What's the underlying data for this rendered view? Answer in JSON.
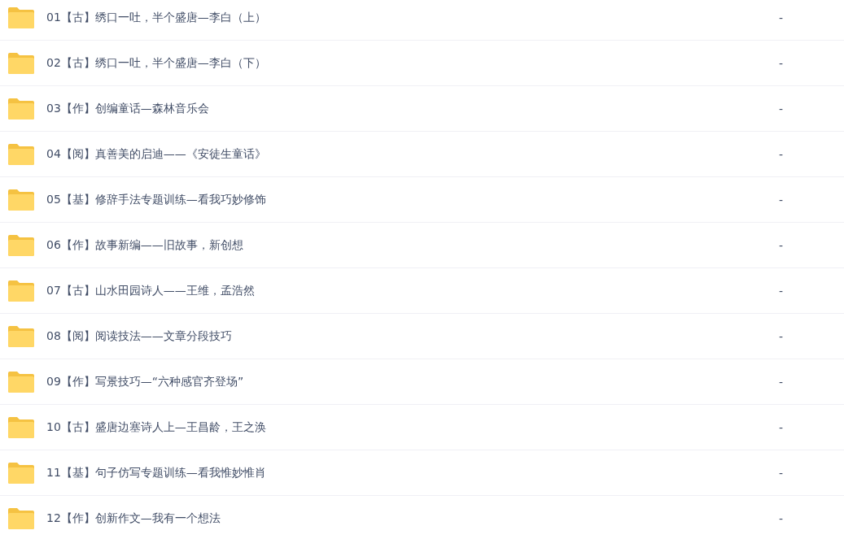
{
  "files": [
    {
      "name": "01【古】绣口一吐，半个盛唐—李白（上）",
      "size": "-"
    },
    {
      "name": "02【古】绣口一吐，半个盛唐—李白（下）",
      "size": "-"
    },
    {
      "name": "03【作】创编童话—森林音乐会",
      "size": "-"
    },
    {
      "name": "04【阅】真善美的启迪——《安徒生童话》",
      "size": "-"
    },
    {
      "name": "05【基】修辞手法专题训练—看我巧妙修饰",
      "size": "-"
    },
    {
      "name": "06【作】故事新编——旧故事，新创想",
      "size": "-"
    },
    {
      "name": "07【古】山水田园诗人——王维，孟浩然",
      "size": "-"
    },
    {
      "name": "08【阅】阅读技法——文章分段技巧",
      "size": "-"
    },
    {
      "name": "09【作】写景技巧—“六种感官齐登场”",
      "size": "-"
    },
    {
      "name": "10【古】盛唐边塞诗人上—王昌龄，王之涣",
      "size": "-"
    },
    {
      "name": "11【基】句子仿写专题训练—看我惟妙惟肖",
      "size": "-"
    },
    {
      "name": "12【作】创新作文—我有一个想法",
      "size": "-"
    }
  ]
}
